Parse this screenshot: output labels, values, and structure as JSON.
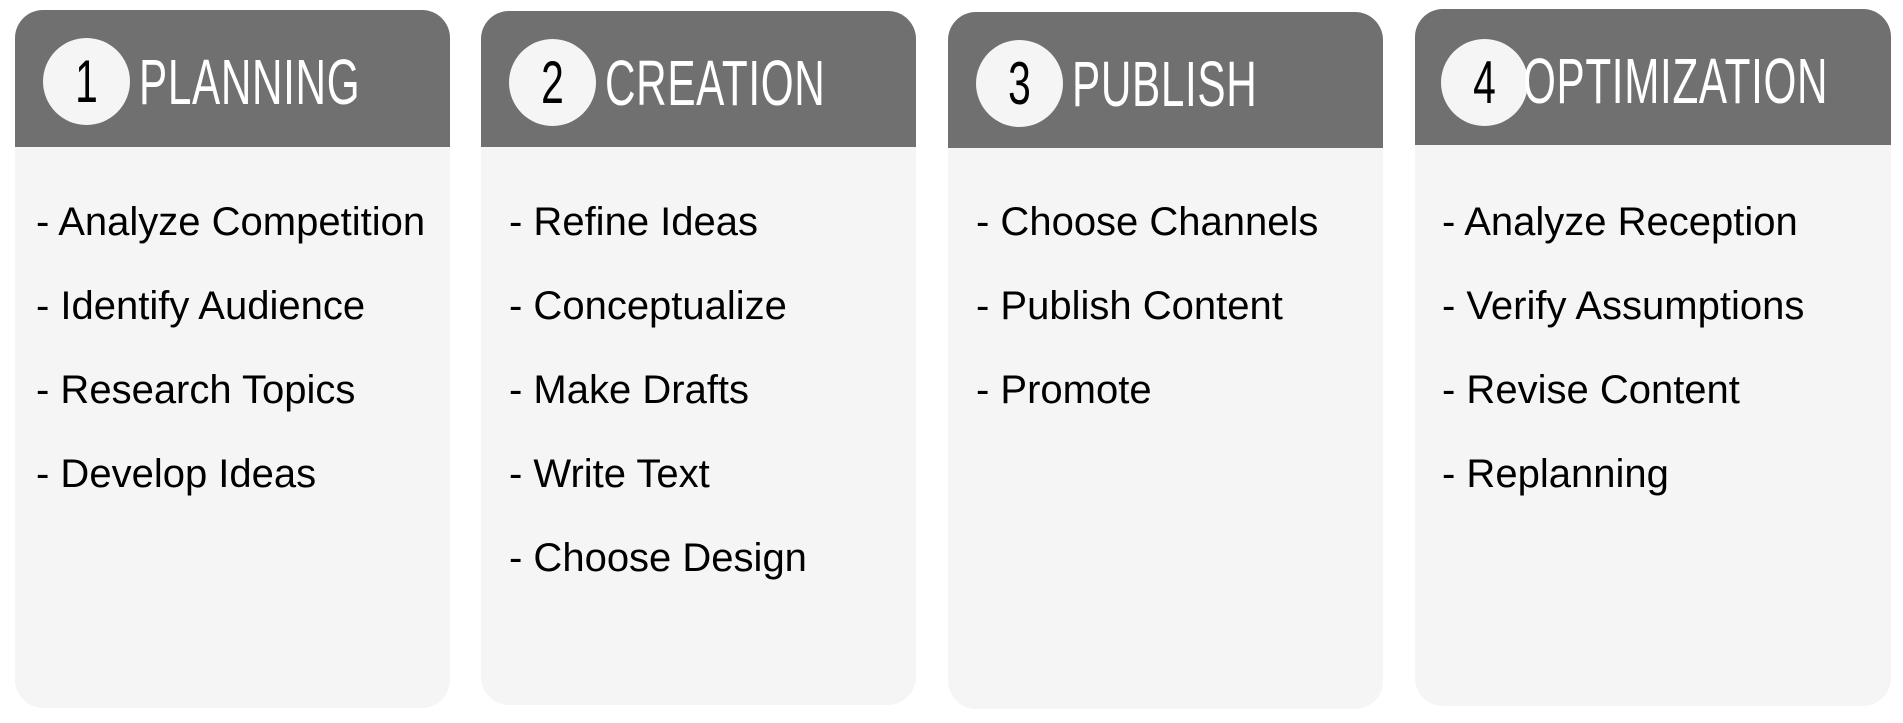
{
  "colors": {
    "header_bg": "#707070",
    "card_bg": "#f5f5f5",
    "title_text": "#ffffff",
    "body_text": "#000000"
  },
  "steps": [
    {
      "number": "1",
      "title": "PLANNING",
      "items": [
        "- Analyze Competition",
        "- Identify Audience",
        "- Research Topics",
        "- Develop Ideas"
      ]
    },
    {
      "number": "2",
      "title": "CREATION",
      "items": [
        "- Refine Ideas",
        "- Conceptualize",
        "- Make Drafts",
        "- Write Text",
        "- Choose Design"
      ]
    },
    {
      "number": "3",
      "title": "PUBLISH",
      "items": [
        "- Choose Channels",
        "- Publish Content",
        "- Promote"
      ]
    },
    {
      "number": "4",
      "title": "OPTIMIZATION",
      "items": [
        "- Analyze Reception",
        "- Verify Assumptions",
        "- Revise Content",
        "- Replanning"
      ]
    }
  ]
}
